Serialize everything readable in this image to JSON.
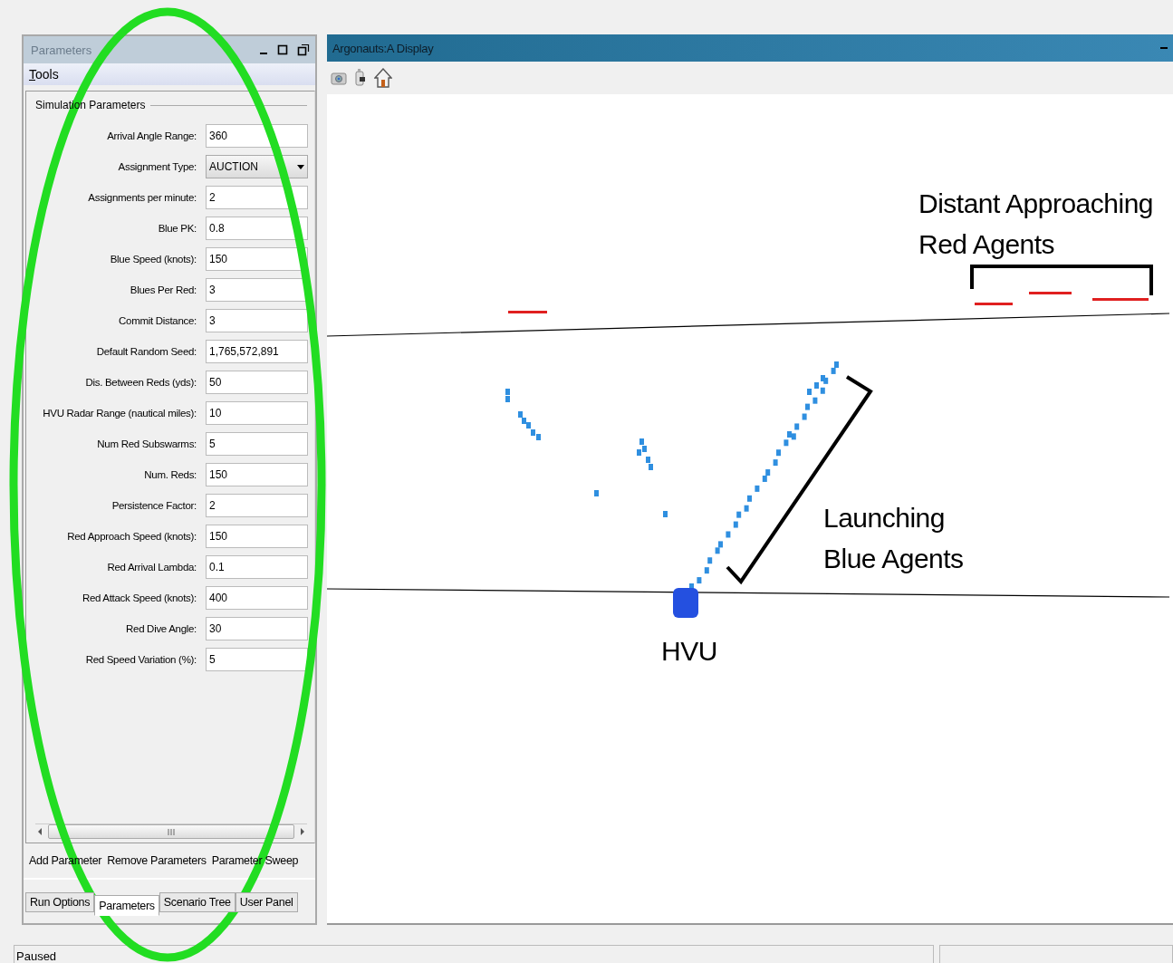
{
  "parameters_panel": {
    "title": "Parameters",
    "menu": [
      {
        "label": "Tools"
      }
    ],
    "group_title": "Simulation Parameters",
    "fields": [
      {
        "label": "Arrival Angle Range:",
        "value": "360",
        "kind": "text"
      },
      {
        "label": "Assignment Type:",
        "value": "AUCTION",
        "kind": "dropdown"
      },
      {
        "label": "Assignments per minute:",
        "value": "2",
        "kind": "text"
      },
      {
        "label": "Blue PK:",
        "value": "0.8",
        "kind": "text"
      },
      {
        "label": "Blue Speed (knots):",
        "value": "150",
        "kind": "text"
      },
      {
        "label": "Blues Per Red:",
        "value": "3",
        "kind": "text"
      },
      {
        "label": "Commit Distance:",
        "value": "3",
        "kind": "text"
      },
      {
        "label": "Default Random Seed:",
        "value": "1,765,572,891",
        "kind": "text"
      },
      {
        "label": "Dis. Between Reds (yds):",
        "value": "50",
        "kind": "text"
      },
      {
        "label": "HVU Radar Range (nautical miles):",
        "value": "10",
        "kind": "text"
      },
      {
        "label": "Num Red Subswarms:",
        "value": "5",
        "kind": "text"
      },
      {
        "label": "Num. Reds:",
        "value": "150",
        "kind": "text"
      },
      {
        "label": "Persistence Factor:",
        "value": "2",
        "kind": "text"
      },
      {
        "label": "Red Approach Speed (knots):",
        "value": "150",
        "kind": "text"
      },
      {
        "label": "Red Arrival Lambda:",
        "value": "0.1",
        "kind": "text"
      },
      {
        "label": "Red Attack Speed (knots):",
        "value": "400",
        "kind": "text"
      },
      {
        "label": "Red Dive Angle:",
        "value": "30",
        "kind": "text"
      },
      {
        "label": "Red Speed Variation (%):",
        "value": "5",
        "kind": "text"
      }
    ],
    "actions": [
      "Add Parameter",
      "Remove Parameters",
      "Parameter Sweep"
    ],
    "tabs": [
      {
        "label": "Run Options",
        "selected": false
      },
      {
        "label": "Parameters",
        "selected": true
      },
      {
        "label": "Scenario Tree",
        "selected": false
      },
      {
        "label": "User Panel",
        "selected": false
      }
    ]
  },
  "display": {
    "title": "Argonauts:A Display",
    "annotations": [
      {
        "kind": "red-group",
        "lines": [
          "Distant Approaching",
          "Red Agents"
        ]
      },
      {
        "kind": "blue-group",
        "lines": [
          "Launching",
          "Blue Agents"
        ]
      },
      {
        "kind": "hvu",
        "lines": [
          "HVU"
        ]
      }
    ]
  },
  "status_bar": {
    "text": "Paused"
  }
}
